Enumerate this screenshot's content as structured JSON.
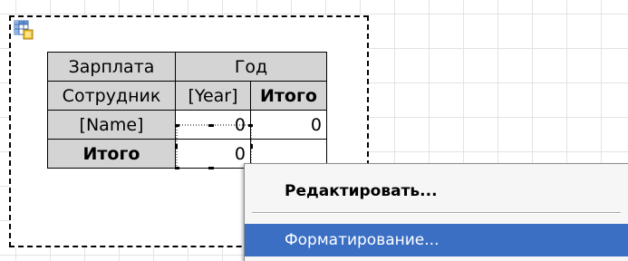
{
  "table": {
    "header_row1": {
      "measure": "Зарплата",
      "column_group": "Год"
    },
    "header_row2": {
      "row_field": "Сотрудник",
      "column_field": "[Year]",
      "total": "Итого"
    },
    "data_row": {
      "row_value": "[Name]",
      "cell_value": "0",
      "total_value": "0"
    },
    "total_row": {
      "label": "Итого",
      "cell_value": "0"
    }
  },
  "context_menu": {
    "items": [
      {
        "label": "Редактировать..."
      },
      {
        "label": "Форматирование..."
      }
    ]
  },
  "colors": {
    "header_fill": "#d4d4d4",
    "menu_highlight": "#3a6fc4",
    "menu_background": "#f6f6f6"
  },
  "icons": {
    "component": "pivot-table-icon"
  }
}
